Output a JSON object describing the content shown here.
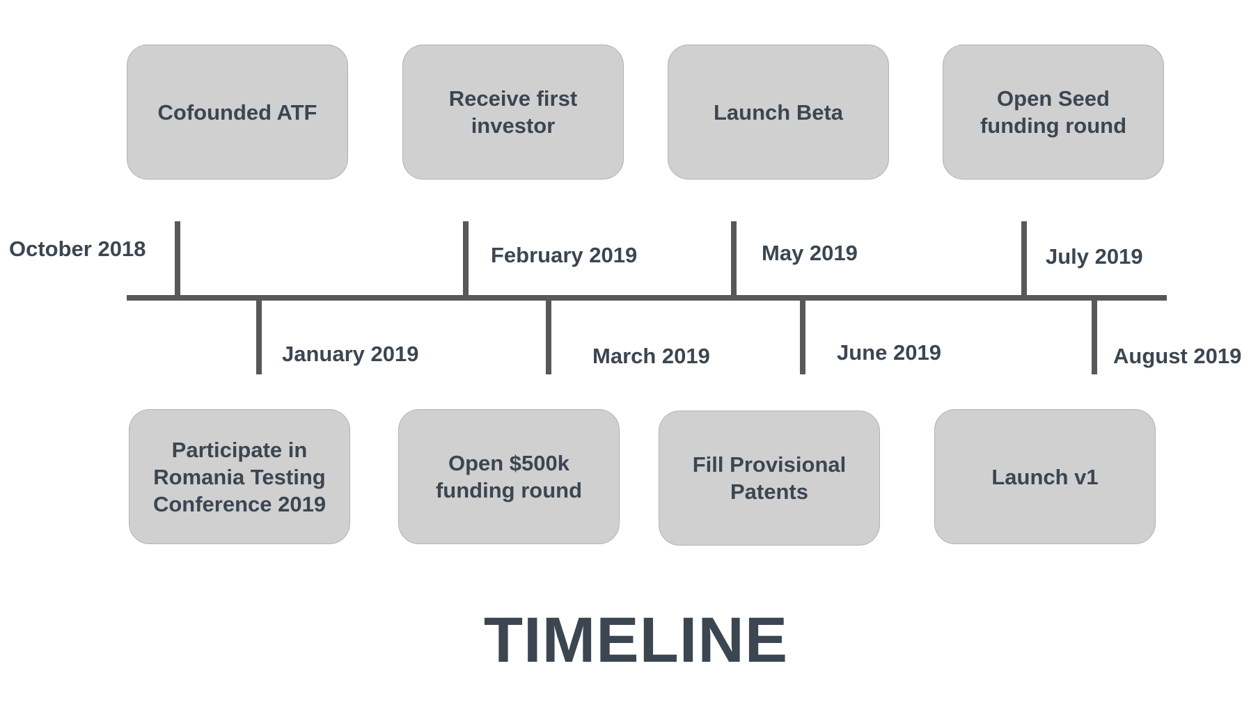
{
  "events_top": [
    {
      "label": "Cofounded ATF",
      "date": "October 2018"
    },
    {
      "label": "Receive first investor",
      "date": "February 2019"
    },
    {
      "label": "Launch Beta",
      "date": "May 2019"
    },
    {
      "label": "Open Seed funding round",
      "date": "July 2019"
    }
  ],
  "events_bottom": [
    {
      "label": "Participate in Romania Testing Conference 2019",
      "date": "January 2019"
    },
    {
      "label": "Open $500k funding round",
      "date": "March 2019"
    },
    {
      "label": "Fill Provisional Patents",
      "date": "June 2019"
    },
    {
      "label": "Launch v1",
      "date": "August 2019"
    }
  ],
  "title": "TIMELINE",
  "colors": {
    "box_fill": "#d0d0d0",
    "box_border": "#aeb2b6",
    "line": "#58585a",
    "text": "#3b4651"
  }
}
